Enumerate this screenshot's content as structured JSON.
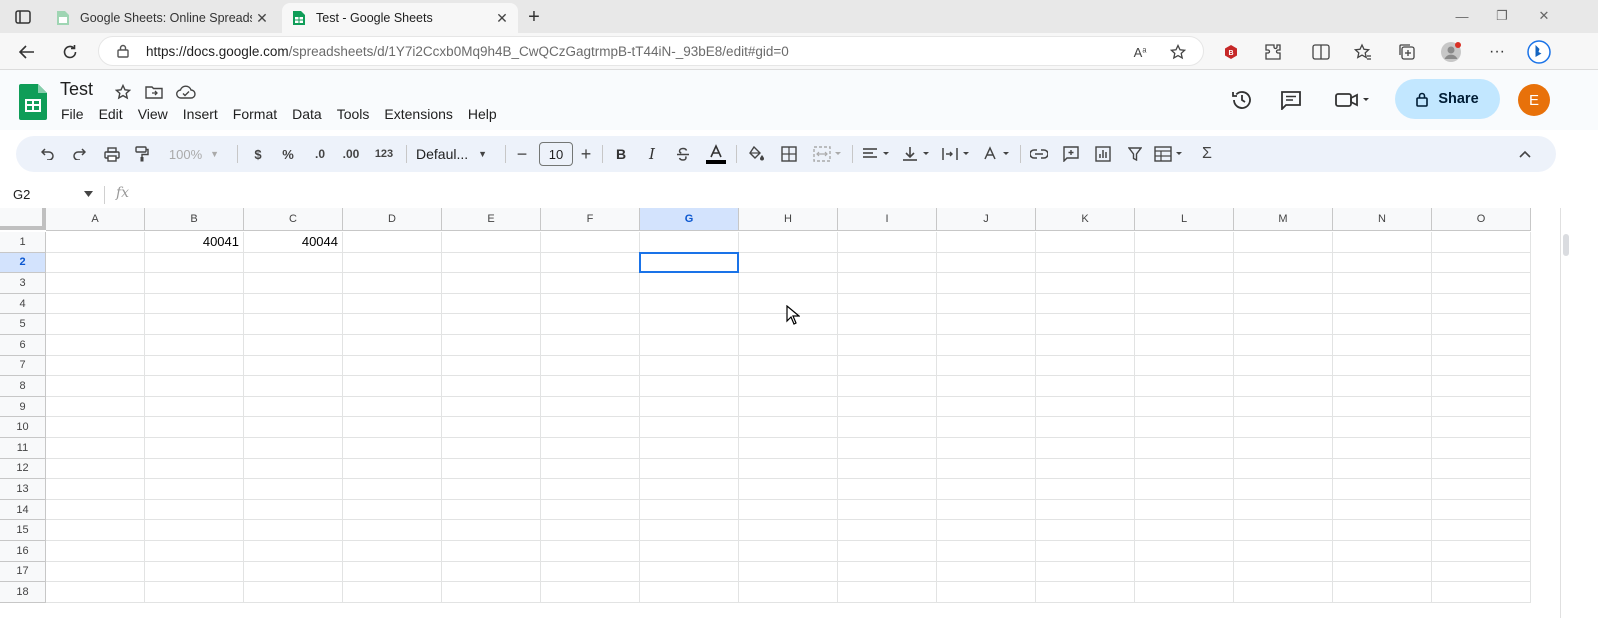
{
  "browser": {
    "tabs": [
      {
        "title": "Google Sheets: Online Spreadshe",
        "active": false
      },
      {
        "title": "Test - Google Sheets",
        "active": true
      }
    ],
    "url_host": "https://docs.google.com",
    "url_path": "/spreadsheets/d/1Y7i2Ccxb0Mq9h4B_CwQCzGagtrmpB-tT44iN-_93bE8/edit#gid=0"
  },
  "doc": {
    "title": "Test",
    "menu": [
      "File",
      "Edit",
      "View",
      "Insert",
      "Format",
      "Data",
      "Tools",
      "Extensions",
      "Help"
    ],
    "share_label": "Share",
    "avatar_letter": "E"
  },
  "toolbar": {
    "zoom": "100%",
    "currency": "$",
    "percent": "%",
    "dec_decrease": ".0",
    "dec_increase": ".00",
    "number_format": "123",
    "font": "Defaul...",
    "font_size": "10",
    "minus": "−",
    "plus": "+",
    "bold": "B",
    "italic": "I",
    "sigma": "Σ"
  },
  "formula_bar": {
    "name_box": "G2",
    "fx": "fx"
  },
  "sheet": {
    "columns": [
      "A",
      "B",
      "C",
      "D",
      "E",
      "F",
      "G",
      "H",
      "I",
      "J",
      "K",
      "L",
      "M",
      "N",
      "O"
    ],
    "rows": [
      "1",
      "2",
      "3",
      "4",
      "5",
      "6",
      "7",
      "8",
      "9",
      "10",
      "11",
      "12",
      "13",
      "14",
      "15",
      "16",
      "17",
      "18"
    ],
    "selected_cell": "G2",
    "cells": {
      "B1": "40041",
      "C1": "40044"
    }
  },
  "colors": {
    "accent": "#1a73e8",
    "share_bg": "#c2e7ff",
    "avatar": "#e8710a",
    "sheets_green": "#0f9d58"
  }
}
